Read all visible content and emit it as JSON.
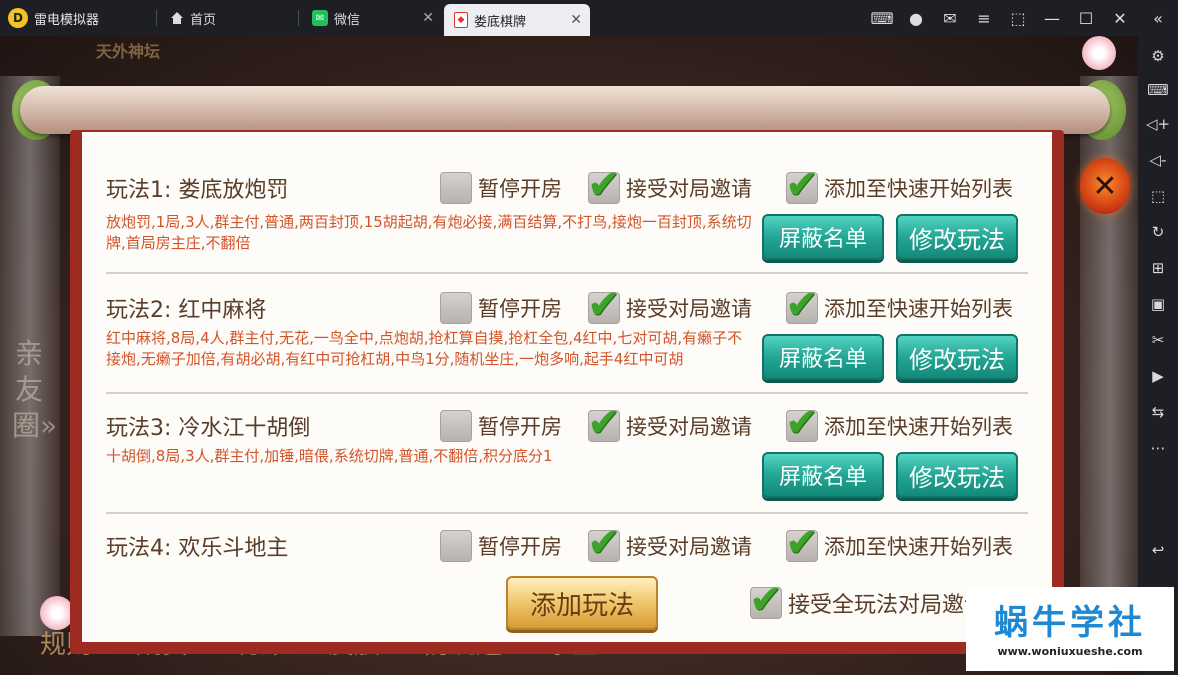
{
  "app": {
    "name": "雷电模拟器",
    "tabs": [
      {
        "label": "首页",
        "icon": "home-icon"
      },
      {
        "label": "微信",
        "icon": "wechat-icon"
      },
      {
        "label": "娄底棋牌",
        "icon": "game-icon"
      }
    ]
  },
  "sidebar_icons": [
    "settings-icon",
    "keyboard-icon",
    "volume-up-icon",
    "volume-down-icon",
    "screenshot-icon",
    "rotate-icon",
    "add-app-icon",
    "apk-icon",
    "scissors-icon",
    "record-icon",
    "sync-icon",
    "more-icon",
    "back-icon"
  ],
  "background": {
    "top_text": "天外神坛",
    "side_vertical": "亲友圈»",
    "bottom_nav": [
      "规则",
      "成员",
      "统计",
      "皮肤",
      "防沉迷",
      "乐豆"
    ]
  },
  "options": {
    "pause": "暂停开房",
    "accept": "接受对局邀请",
    "quick": "添加至快速开始列表"
  },
  "buttons": {
    "block": "屏蔽名单",
    "modify": "修改玩法",
    "add_rule": "添加玩法",
    "accept_all": "接受全玩法对局邀请",
    "close": "✕"
  },
  "rules": [
    {
      "title": "玩法1:  娄底放炮罚",
      "desc": "放炮罚,1局,3人,群主付,普通,两百封顶,15胡起胡,有炮必接,满百结算,不打鸟,接炮一百封顶,系统切牌,首局房主庄,不翻倍",
      "pause": false,
      "accept": true,
      "quick": true
    },
    {
      "title": "玩法2:  红中麻将",
      "desc": "红中麻将,8局,4人,群主付,无花,一鸟全中,点炮胡,抢杠算自摸,抢杠全包,4红中,七对可胡,有癞子不接炮,无癞子加倍,有胡必胡,有红中可抢杠胡,中鸟1分,随机坐庄,一炮多响,起手4红中可胡",
      "pause": false,
      "accept": true,
      "quick": true
    },
    {
      "title": "玩法3:  冷水江十胡倒",
      "desc": "十胡倒,8局,3人,群主付,加锤,暗偎,系统切牌,普通,不翻倍,积分底分1",
      "pause": false,
      "accept": true,
      "quick": true
    },
    {
      "title": "玩法4:  欢乐斗地主",
      "desc": "",
      "pause": false,
      "accept": true,
      "quick": true
    }
  ],
  "accept_all_checked": true,
  "watermark": {
    "title": "蜗牛学社",
    "url": "www.woniuxueshe.com"
  }
}
